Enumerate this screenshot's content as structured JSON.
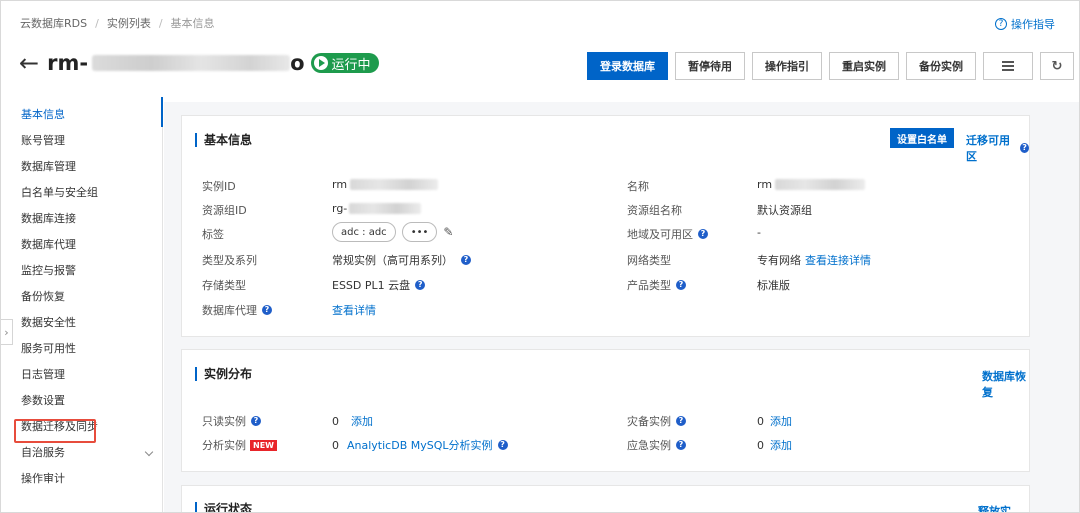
{
  "breadcrumb": [
    "云数据库RDS",
    "实例列表",
    "基本信息"
  ],
  "help_label": "操作指导",
  "instance": {
    "name_prefix": "rm-",
    "name_suffix": "o",
    "status": "运行中"
  },
  "toolbar": {
    "login": "登录数据库",
    "suspend": "暂停待用",
    "guide": "操作指引",
    "restart": "重启实例",
    "backup": "备份实例",
    "menu_icon": "menu-icon",
    "refresh_icon": "refresh-icon"
  },
  "sidebar": {
    "items": [
      {
        "label": "基本信息"
      },
      {
        "label": "账号管理"
      },
      {
        "label": "数据库管理"
      },
      {
        "label": "白名单与安全组"
      },
      {
        "label": "数据库连接"
      },
      {
        "label": "数据库代理"
      },
      {
        "label": "监控与报警"
      },
      {
        "label": "备份恢复"
      },
      {
        "label": "数据安全性"
      },
      {
        "label": "服务可用性"
      },
      {
        "label": "日志管理"
      },
      {
        "label": "参数设置"
      },
      {
        "label": "数据迁移及同步"
      },
      {
        "label": "自治服务"
      },
      {
        "label": "操作审计"
      }
    ]
  },
  "basic": {
    "title": "基本信息",
    "whitelist_btn": "设置白名单",
    "migrate_az": "迁移可用区",
    "left": {
      "instance_id_label": "实例ID",
      "instance_id_prefix": "rm",
      "rg_id_label": "资源组ID",
      "rg_id_prefix": "rg-",
      "tags_label": "标签",
      "tag_value": "adc : adc",
      "tag_more": "•••",
      "type_label": "类型及系列",
      "type_value": "常规实例（高可用系列）",
      "storage_label": "存储类型",
      "storage_value": "ESSD PL1 云盘",
      "proxy_label": "数据库代理",
      "proxy_value": "查看详情"
    },
    "right": {
      "name_label": "名称",
      "name_prefix": "rm",
      "rg_name_label": "资源组名称",
      "rg_name_value": "默认资源组",
      "region_label": "地域及可用区",
      "region_value": "-",
      "network_label": "网络类型",
      "network_value": "专有网络",
      "network_link": "查看连接详情",
      "product_label": "产品类型",
      "product_value": "标准版"
    }
  },
  "distribution": {
    "title": "实例分布",
    "restore_link": "数据库恢复",
    "readonly_label": "只读实例",
    "readonly_count": "0",
    "readonly_add": "添加",
    "analytic_label": "分析实例",
    "analytic_badge": "NEW",
    "analytic_count": "0",
    "analytic_link": "AnalyticDB MySQL分析实例",
    "standby_label": "灾备实例",
    "standby_count": "0",
    "standby_add": "添加",
    "emergency_label": "应急实例",
    "emergency_count": "0",
    "emergency_add": "添加"
  },
  "runstate": {
    "title": "运行状态",
    "release_link": "释放实例"
  }
}
